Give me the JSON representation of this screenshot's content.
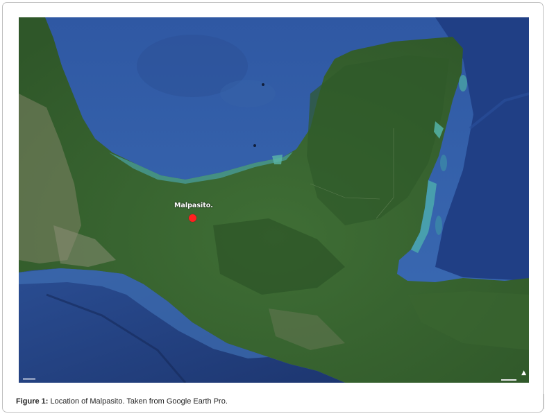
{
  "map": {
    "type": "satellite",
    "marker": {
      "label": "Malpasito.",
      "color": "#ff2020"
    },
    "colors": {
      "ocean_deep": "#233f7a",
      "ocean_shelf": "#3e6bb0",
      "coast_shallow": "#4aa9a8",
      "land": "#3d6a34",
      "land_dark": "#2c5126",
      "mountains": "#8a8a70"
    },
    "icons": {
      "north": "north-arrow-icon"
    }
  },
  "caption": {
    "label": "Figure 1:",
    "text": " Location of Malpasito. Taken from Google Earth Pro."
  }
}
